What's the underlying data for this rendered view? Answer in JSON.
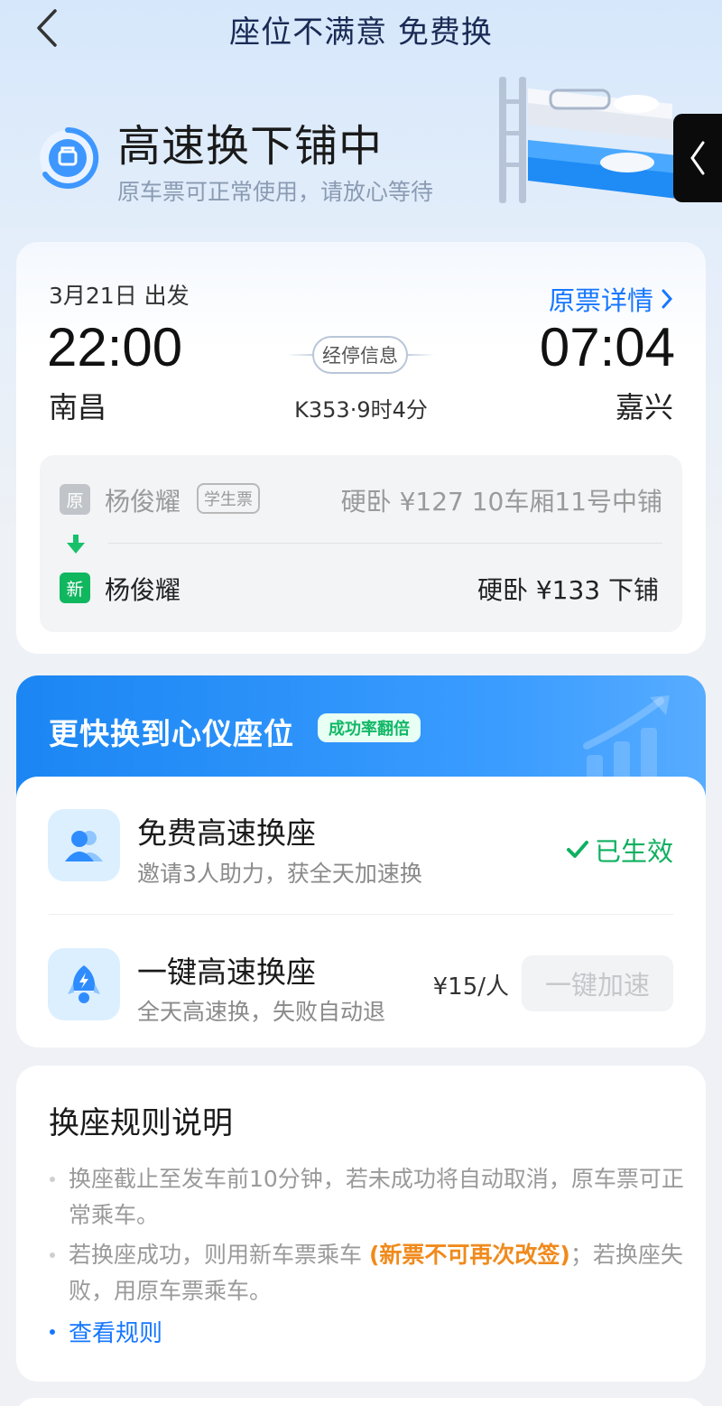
{
  "nav": {
    "title": "座位不满意 免费换"
  },
  "status": {
    "title": "高速换下铺中",
    "subtitle": "原车票可正常使用，请放心等待"
  },
  "trip": {
    "date": "3月21日 出发",
    "original_ticket_link": "原票详情",
    "departure_time": "22:00",
    "arrival_time": "07:04",
    "departure_station": "南昌",
    "arrival_station": "嘉兴",
    "stops_button": "经停信息",
    "train_info": "K353·9时4分"
  },
  "passengers": {
    "old": {
      "tag": "原",
      "name": "杨俊耀",
      "badge": "学生票",
      "seat": "硬卧 ¥127 10车厢11号中铺"
    },
    "new": {
      "tag": "新",
      "name": "杨俊耀",
      "seat": "硬卧 ¥133 下铺"
    }
  },
  "speed": {
    "title": "更快换到心仪座位",
    "badge": "成功率翻倍",
    "option1": {
      "title": "免费高速换座",
      "subtitle": "邀请3人助力，获全天加速换",
      "status": "已生效"
    },
    "option2": {
      "title": "一键高速换座",
      "subtitle": "全天高速换，失败自动退",
      "price": "¥15/人",
      "button": "一键加速"
    }
  },
  "rules": {
    "title": "换座规则说明",
    "rule1": "换座截止至发车前10分钟，若未成功将自动取消，原车票可正常乘车。",
    "rule2_prefix": "若换座成功，则用新车票乘车 ",
    "rule2_warning": "(新票不可再次改签)",
    "rule2_suffix": "；若换座失败，用原车票乘车。",
    "link": "查看规则"
  },
  "colors": {
    "accent": "#1677ff",
    "success": "#10b060",
    "warning": "#f08a1c",
    "banner": "#1b86f3"
  }
}
